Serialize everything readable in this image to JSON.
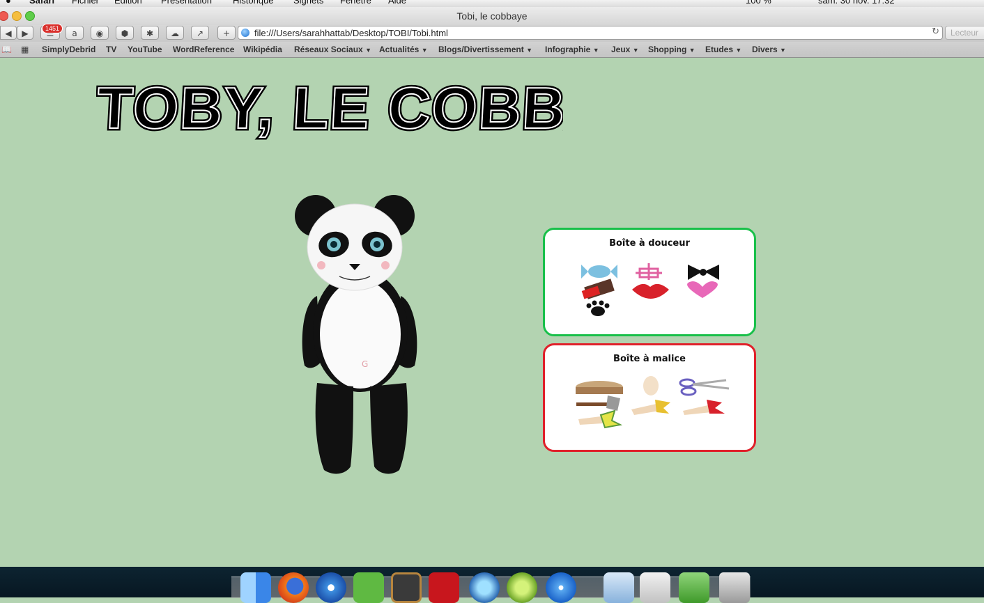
{
  "menubar": {
    "app": "Safari",
    "items": [
      "Fichier",
      "Édition",
      "Présentation",
      "Historique",
      "Signets",
      "Fenêtre",
      "Aide"
    ],
    "battery": "100 %",
    "clock": "sam. 30 nov.  17:32"
  },
  "window": {
    "title": "Tobi, le cobbaye"
  },
  "toolbar": {
    "badge": "1451",
    "url": "file:///Users/sarahhattab/Desktop/TOBI/Tobi.html",
    "reader_label": "Lecteur"
  },
  "bookmarks": [
    {
      "label": "SimplyDebrid",
      "menu": false
    },
    {
      "label": "TV",
      "menu": false
    },
    {
      "label": "YouTube",
      "menu": false
    },
    {
      "label": "WordReference",
      "menu": false
    },
    {
      "label": "Wikipédia",
      "menu": false
    },
    {
      "label": "Réseaux Sociaux",
      "menu": true
    },
    {
      "label": "Actualités",
      "menu": true
    },
    {
      "label": "Blogs/Divertissement",
      "menu": true
    },
    {
      "label": "Infographie",
      "menu": true
    },
    {
      "label": "Jeux",
      "menu": true
    },
    {
      "label": "Shopping",
      "menu": true
    },
    {
      "label": "Etudes",
      "menu": true
    },
    {
      "label": "Divers",
      "menu": true
    }
  ],
  "page": {
    "heading": "TOBY, LE COBBAYE",
    "box_douceur": {
      "title": "Boîte à douceur",
      "items": [
        "candy-icon",
        "gift-icon",
        "bow-tie-icon",
        "chocolate-icon",
        "lips-icon",
        "heart-icon",
        "paw-icon"
      ]
    },
    "box_malice": {
      "title": "Boîte à malice",
      "items": [
        "pie-icon",
        "egg-icon",
        "scissors-icon",
        "axe-icon",
        "hand-slap-icon",
        "hand-hit-icon",
        "hand-tickle-icon"
      ]
    }
  },
  "colors": {
    "page_background": "#b3d3b1",
    "douceur_border": "#19c04a",
    "malice_border": "#e0202a"
  },
  "dock": {
    "items": [
      "finder-icon",
      "firefox-icon",
      "itunes-icon",
      "evernote-icon",
      "chalkboard-icon",
      "filezilla-icon",
      "photoshop-icon",
      "dreamweaver-icon",
      "safari-icon",
      "folder-icon",
      "documents-icon",
      "downloads-icon",
      "trash-icon"
    ]
  }
}
